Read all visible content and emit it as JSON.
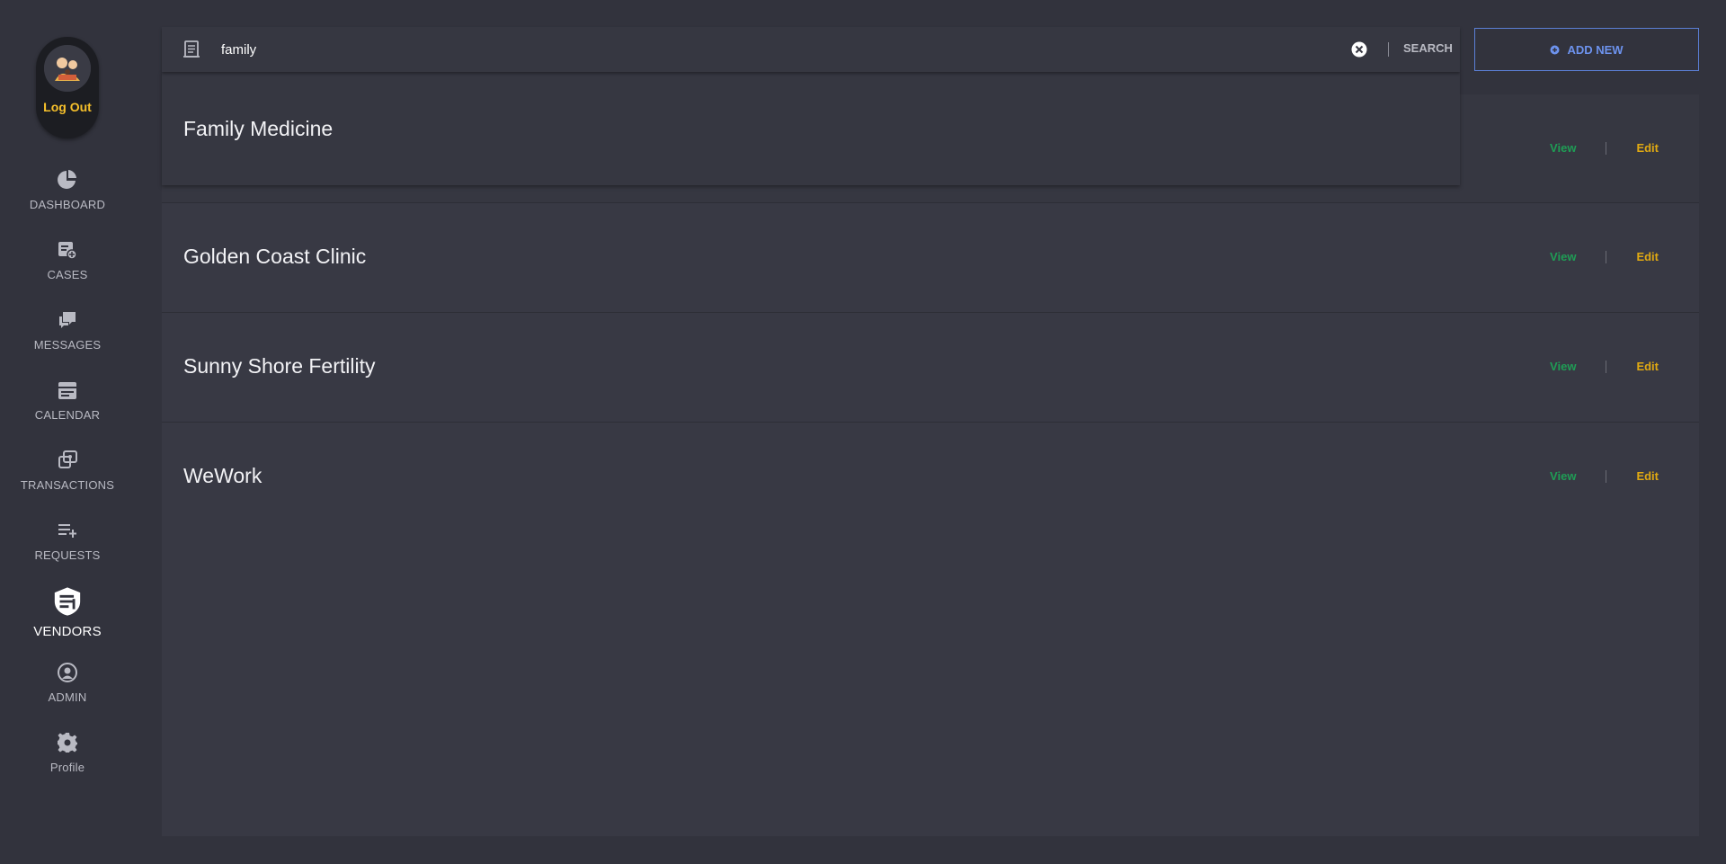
{
  "sidebar": {
    "logout_label": "Log Out",
    "items": [
      {
        "label": "DASHBOARD",
        "icon": "pie-chart-icon"
      },
      {
        "label": "CASES",
        "icon": "cases-icon"
      },
      {
        "label": "MESSAGES",
        "icon": "messages-icon"
      },
      {
        "label": "CALENDAR",
        "icon": "calendar-icon"
      },
      {
        "label": "TRANSACTIONS",
        "icon": "transactions-icon"
      },
      {
        "label": "REQUESTS",
        "icon": "requests-icon"
      },
      {
        "label": "VENDORS",
        "icon": "vendors-icon"
      },
      {
        "label": "ADMIN",
        "icon": "admin-icon"
      },
      {
        "label": "Profile",
        "icon": "gear-icon"
      }
    ],
    "active": "VENDORS"
  },
  "search": {
    "value": "family",
    "button_label": "SEARCH"
  },
  "add_new_label": "ADD NEW",
  "vendors": [
    {
      "name": "Family Medicine",
      "view_label": "View",
      "edit_label": "Edit"
    },
    {
      "name": "Golden Coast Clinic",
      "view_label": "View",
      "edit_label": "Edit"
    },
    {
      "name": "Sunny Shore Fertility",
      "view_label": "View",
      "edit_label": "Edit"
    },
    {
      "name": "WeWork",
      "view_label": "View",
      "edit_label": "Edit"
    }
  ],
  "colors": {
    "background": "#32333d",
    "panel": "#383944",
    "accent_blue": "#6d93ee",
    "view_green": "#1f9d55",
    "edit_yellow": "#e0a912",
    "logout_yellow": "#f6c02b"
  }
}
